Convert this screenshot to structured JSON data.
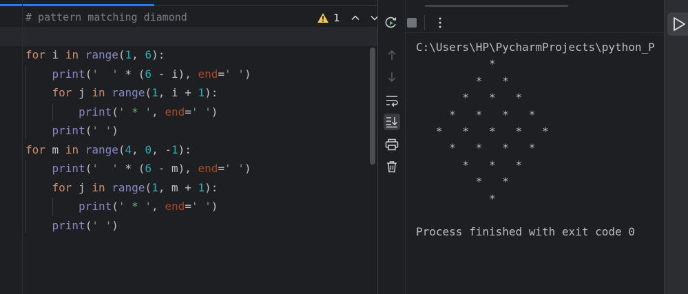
{
  "editor": {
    "sticky_comment": "# pattern matching diamond",
    "inspection_count": "1",
    "lines": [
      [
        [
          "for",
          "kw"
        ],
        [
          " i ",
          ""
        ],
        [
          "in",
          "kw"
        ],
        [
          " ",
          ""
        ],
        [
          "range",
          "bi"
        ],
        [
          "(",
          ""
        ],
        [
          "1",
          "num"
        ],
        [
          ", ",
          ""
        ],
        [
          "6",
          "num"
        ],
        [
          "):",
          ""
        ]
      ],
      [
        [
          "    ",
          ""
        ],
        [
          "print",
          "bi"
        ],
        [
          "(",
          ""
        ],
        [
          "'  '",
          "str"
        ],
        [
          " * (",
          ""
        ],
        [
          "6",
          "num"
        ],
        [
          " - i), ",
          ""
        ],
        [
          "end",
          "param"
        ],
        [
          "=",
          ""
        ],
        [
          "' '",
          "str"
        ],
        [
          ")",
          ""
        ]
      ],
      [
        [
          "    ",
          ""
        ],
        [
          "for",
          "kw"
        ],
        [
          " j ",
          ""
        ],
        [
          "in",
          "kw"
        ],
        [
          " ",
          ""
        ],
        [
          "range",
          "bi"
        ],
        [
          "(",
          ""
        ],
        [
          "1",
          "num"
        ],
        [
          ", i + ",
          ""
        ],
        [
          "1",
          "num"
        ],
        [
          "):",
          ""
        ]
      ],
      [
        [
          "        ",
          ""
        ],
        [
          "print",
          "bi"
        ],
        [
          "(",
          ""
        ],
        [
          "' * '",
          "str"
        ],
        [
          ", ",
          ""
        ],
        [
          "end",
          "param"
        ],
        [
          "=",
          ""
        ],
        [
          "' '",
          "str"
        ],
        [
          ")",
          ""
        ]
      ],
      [
        [
          "    ",
          ""
        ],
        [
          "print",
          "bi"
        ],
        [
          "(",
          ""
        ],
        [
          "' '",
          "str"
        ],
        [
          ")",
          ""
        ]
      ],
      [
        [
          "for",
          "kw"
        ],
        [
          " m ",
          ""
        ],
        [
          "in",
          "kw"
        ],
        [
          " ",
          ""
        ],
        [
          "range",
          "bi"
        ],
        [
          "(",
          ""
        ],
        [
          "4",
          "num"
        ],
        [
          ", ",
          ""
        ],
        [
          "0",
          "num"
        ],
        [
          ", -",
          ""
        ],
        [
          "1",
          "num"
        ],
        [
          "):",
          ""
        ]
      ],
      [
        [
          "    ",
          ""
        ],
        [
          "print",
          "bi"
        ],
        [
          "(",
          ""
        ],
        [
          "'  '",
          "str"
        ],
        [
          " * (",
          ""
        ],
        [
          "6",
          "num"
        ],
        [
          " - m), ",
          ""
        ],
        [
          "end",
          "param"
        ],
        [
          "=",
          ""
        ],
        [
          "' '",
          "str"
        ],
        [
          ")",
          ""
        ]
      ],
      [
        [
          "    ",
          ""
        ],
        [
          "for",
          "kw"
        ],
        [
          " j ",
          ""
        ],
        [
          "in",
          "kw"
        ],
        [
          " ",
          ""
        ],
        [
          "range",
          "bi"
        ],
        [
          "(",
          ""
        ],
        [
          "1",
          "num"
        ],
        [
          ", m + ",
          ""
        ],
        [
          "1",
          "num"
        ],
        [
          "):",
          ""
        ]
      ],
      [
        [
          "        ",
          ""
        ],
        [
          "print",
          "bi"
        ],
        [
          "(",
          ""
        ],
        [
          "' * '",
          "str"
        ],
        [
          ", ",
          ""
        ],
        [
          "end",
          "param"
        ],
        [
          "=",
          ""
        ],
        [
          "' '",
          "str"
        ],
        [
          ")",
          ""
        ]
      ],
      [
        [
          "    ",
          ""
        ],
        [
          "print",
          "bi"
        ],
        [
          "(",
          ""
        ],
        [
          "' '",
          "str"
        ],
        [
          ")",
          ""
        ]
      ]
    ]
  },
  "run": {
    "console_lines": [
      "C:\\Users\\HP\\PycharmProjects\\python_P",
      "           *",
      "         *   *",
      "       *   *   *",
      "     *   *   *   *",
      "   *   *   *   *   *",
      "     *   *   *   *",
      "       *   *   *",
      "         *   *",
      "           *",
      "",
      "Process finished with exit code 0"
    ]
  },
  "icons": {
    "warning": "warning-icon",
    "prev": "chevron-up-icon",
    "next": "chevron-down-icon",
    "rerun": "rerun-icon",
    "stop": "stop-icon",
    "more": "more-vertical-icon",
    "up": "arrow-up-icon",
    "down": "arrow-down-icon",
    "wrap": "soft-wrap-icon",
    "scroll_end": "scroll-to-end-icon",
    "print": "print-icon",
    "clear": "trash-icon",
    "run": "run-icon"
  },
  "colors": {
    "keyword": "#cf8e6d",
    "builtin": "#8888c6",
    "number": "#2aacb8",
    "string": "#6aab73",
    "param": "#aa4926",
    "warning": "#f2c55c",
    "accent": "#3574f0"
  }
}
